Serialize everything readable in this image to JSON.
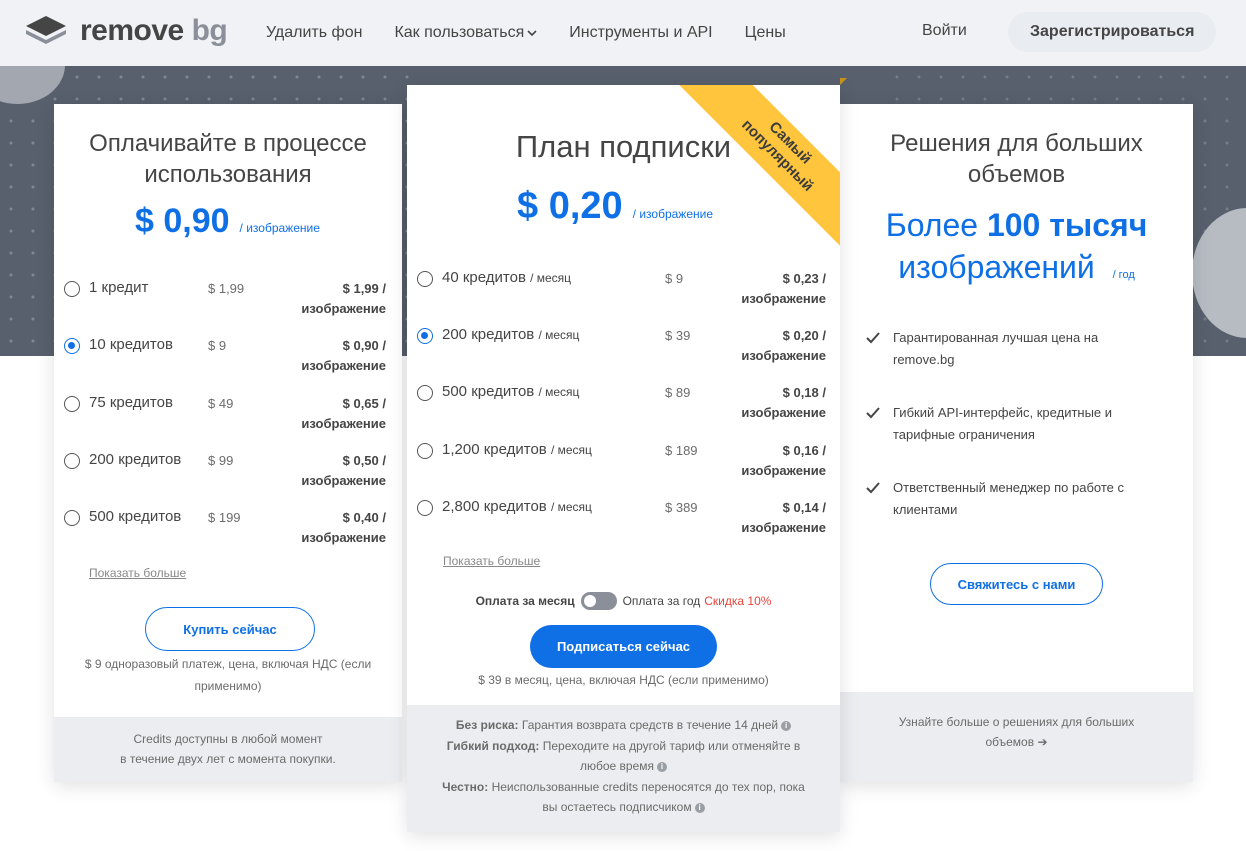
{
  "nav": {
    "logo_main": "remove",
    "logo_bg": "bg",
    "links": [
      "Удалить фон",
      "Как пользоваться",
      "Инструменты и API",
      "Цены"
    ],
    "login": "Войти",
    "signup": "Зарегистрироваться"
  },
  "payg": {
    "title_line1": "Оплачивайте в процессе",
    "title_line2": "использования",
    "price": "$ 0,90",
    "price_unit": "/ изображение",
    "rows": [
      {
        "label": "1 кредит",
        "amount": "$ 1,99",
        "per_line1": "$ 1,99 /",
        "per_line2": "изображение",
        "selected": false
      },
      {
        "label": "10 кредитов",
        "amount": "$ 9",
        "per_line1": "$ 0,90 /",
        "per_line2": "изображение",
        "selected": true
      },
      {
        "label": "75 кредитов",
        "amount": "$ 49",
        "per_line1": "$ 0,65 /",
        "per_line2": "изображение",
        "selected": false
      },
      {
        "label": "200 кредитов",
        "amount": "$ 99",
        "per_line1": "$ 0,50 /",
        "per_line2": "изображение",
        "selected": false
      },
      {
        "label": "500 кредитов",
        "amount": "$ 199",
        "per_line1": "$ 0,40 /",
        "per_line2": "изображение",
        "selected": false
      }
    ],
    "show_more": "Показать больше",
    "button": "Купить сейчас",
    "note_line1": "$ 9 одноразовый платеж, цена, включая НДС (если",
    "note_line2": "применимо)",
    "footer_line1": "Credits доступны в любой момент",
    "footer_line2": "в течение двух лет с момента покупки."
  },
  "sub": {
    "ribbon_line1": "Самый",
    "ribbon_line2": "популярный",
    "title": "План подписки",
    "price": "$ 0,20",
    "price_unit": "/ изображение",
    "per_month": "/ месяц",
    "rows": [
      {
        "label": "40 кредитов",
        "amount": "$ 9",
        "per_line1": "$ 0,23 /",
        "per_line2": "изображение",
        "selected": false
      },
      {
        "label": "200 кредитов",
        "amount": "$ 39",
        "per_line1": "$ 0,20 /",
        "per_line2": "изображение",
        "selected": true
      },
      {
        "label": "500 кредитов",
        "amount": "$ 89",
        "per_line1": "$ 0,18 /",
        "per_line2": "изображение",
        "selected": false
      },
      {
        "label": "1,200 кредитов",
        "amount": "$ 189",
        "per_line1": "$ 0,16 /",
        "per_line2": "изображение",
        "selected": false
      },
      {
        "label": "2,800 кредитов",
        "amount": "$ 389",
        "per_line1": "$ 0,14 /",
        "per_line2": "изображение",
        "selected": false
      }
    ],
    "show_more": "Показать больше",
    "toggle_left": "Оплата за месяц",
    "toggle_right": "Оплата за год",
    "toggle_discount": "Скидка 10%",
    "button": "Подписаться сейчас",
    "note": "$ 39 в месяц, цена, включая НДС (если применимо)",
    "f1_bold": "Без риска:",
    "f1_text": "Гарантия возврата средств в течение 14 дней",
    "f2_bold": "Гибкий подход:",
    "f2_text1": "Переходите на другой тариф или отменяйте в",
    "f2_text2": "любое время",
    "f3_bold": "Честно:",
    "f3_text1": "Неиспользованные credits переносятся до тех пор, пока",
    "f3_text2": "вы остаетесь подписчиком",
    "info_glyph": "i"
  },
  "enterprise": {
    "title_line1": "Решения для больших",
    "title_line2": "объемов",
    "big_pre": "Более ",
    "big_bold": "100 тысяч",
    "big_line2": "изображений",
    "big_unit": "/ год",
    "features": [
      [
        "Гарантированная лучшая цена на",
        "remove.bg"
      ],
      [
        "Гибкий API-интерфейс, кредитные и",
        "тарифные ограничения"
      ],
      [
        "Ответственный менеджер по работе с",
        "клиентами"
      ]
    ],
    "button": "Свяжитесь с нами",
    "footer_line1": "Узнайте больше о решениях для больших",
    "footer_line2": "объемов",
    "footer_arrow": "➔"
  }
}
